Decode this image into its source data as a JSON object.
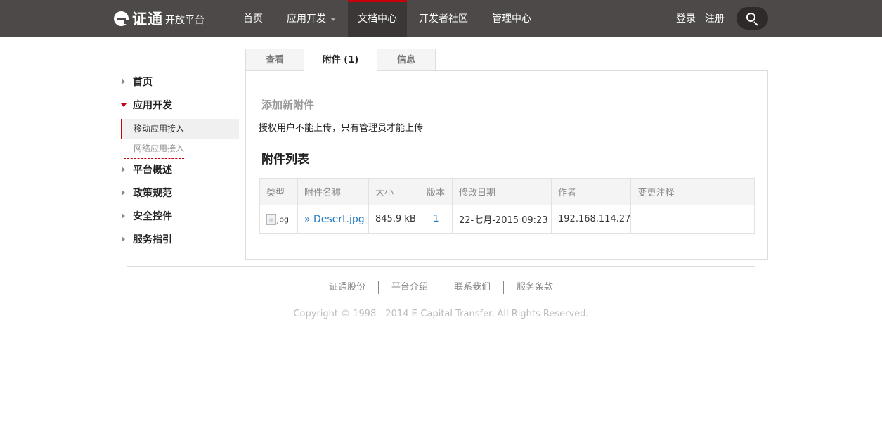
{
  "header": {
    "brand_name": "证通",
    "brand_sub": "开放平台",
    "nav": [
      {
        "label": "首页"
      },
      {
        "label": "应用开发"
      },
      {
        "label": "文档中心"
      },
      {
        "label": "开发者社区"
      },
      {
        "label": "管理中心"
      }
    ],
    "active_nav": "文档中心",
    "login_label": "登录",
    "register_label": "注册",
    "search_icon": "search-icon",
    "accent_color": "#c7000b"
  },
  "sidebar": {
    "items": [
      {
        "label": "首页"
      },
      {
        "label": "应用开发"
      },
      {
        "label": "平台概述"
      },
      {
        "label": "政策规范"
      },
      {
        "label": "安全控件"
      },
      {
        "label": "服务指引"
      }
    ],
    "sub_items": [
      {
        "label": "移动应用接入"
      },
      {
        "label": "网络应用接入"
      }
    ]
  },
  "tabs": [
    {
      "label": "查看"
    },
    {
      "label": "附件 (1)"
    },
    {
      "label": "信息"
    }
  ],
  "attachments": {
    "add_title": "添加新附件",
    "notice": "授权用户不能上传，只有管理员才能上传",
    "list_title": "附件列表",
    "columns": [
      "类型",
      "附件名称",
      "大小",
      "版本",
      "修改日期",
      "作者",
      "变更注释"
    ],
    "rows": [
      {
        "type": "jpg",
        "name": "» Desert.jpg",
        "size": "845.9 kB",
        "version": "1",
        "modified": "22-七月-2015 09:23",
        "author": "192.168.114.27",
        "comment": ""
      }
    ]
  },
  "footer": {
    "links": [
      "证通股份",
      "平台介绍",
      "联系我们",
      "服务条款"
    ],
    "copyright": "Copyright © 1998 - 2014 E-Capital Transfer. All Rights Reserved."
  }
}
